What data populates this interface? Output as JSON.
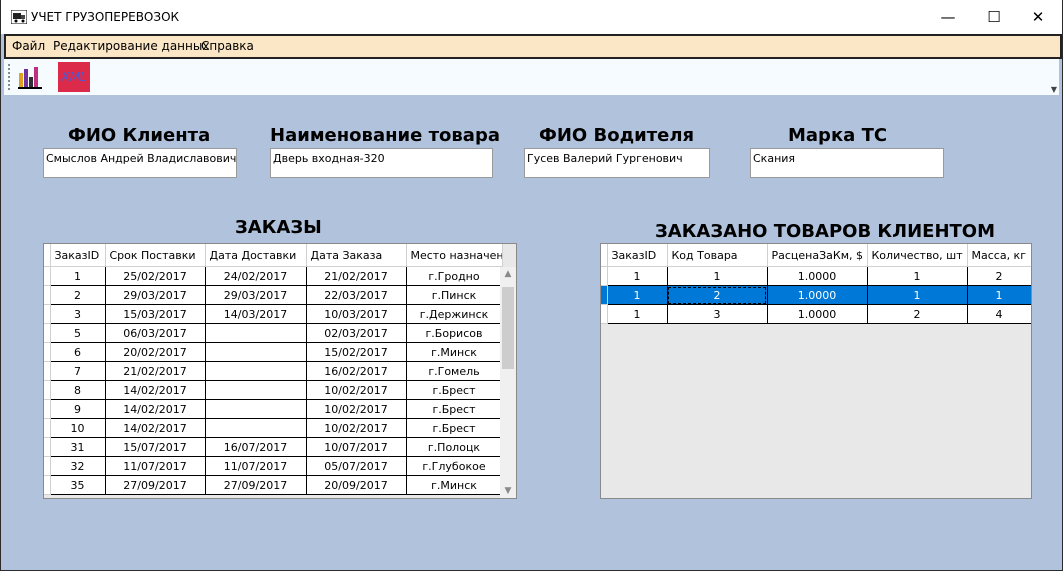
{
  "window": {
    "title": "УЧЕТ ГРУЗОПЕРЕВОЗОК",
    "minimize": "—",
    "maximize": "☐",
    "close": "✕"
  },
  "menu": [
    "Файл",
    "Редактирование данных",
    "Справка"
  ],
  "toolbar": {
    "chart_icon": "bar-chart-icon",
    "xml_label": "XML"
  },
  "fields": {
    "client_label": "ФИО Клиента",
    "client_value": "Смыслов Андрей Владиславович",
    "product_label": "Наименование товара",
    "product_value": "Дверь входная-320",
    "driver_label": "ФИО Водителя",
    "driver_value": "Гусев Валерий Гургенович",
    "vehicle_label": "Марка ТС",
    "vehicle_value": "Скания"
  },
  "orders": {
    "title": "ЗАКАЗЫ",
    "columns": [
      "ЗаказID",
      "Срок Поставки",
      "Дата Доставки",
      "Дата Заказа",
      "Место назначения"
    ],
    "rows": [
      [
        "1",
        "25/02/2017",
        "24/02/2017",
        "21/02/2017",
        "г.Гродно"
      ],
      [
        "2",
        "29/03/2017",
        "29/03/2017",
        "22/03/2017",
        "г.Пинск"
      ],
      [
        "3",
        "15/03/2017",
        "14/03/2017",
        "10/03/2017",
        "г.Держинск"
      ],
      [
        "5",
        "06/03/2017",
        "",
        "02/03/2017",
        "г.Борисов"
      ],
      [
        "6",
        "20/02/2017",
        "",
        "15/02/2017",
        "г.Минск"
      ],
      [
        "7",
        "21/02/2017",
        "",
        "16/02/2017",
        "г.Гомель"
      ],
      [
        "8",
        "14/02/2017",
        "",
        "10/02/2017",
        "г.Брест"
      ],
      [
        "9",
        "14/02/2017",
        "",
        "10/02/2017",
        "г.Брест"
      ],
      [
        "10",
        "14/02/2017",
        "",
        "10/02/2017",
        "г.Брест"
      ],
      [
        "31",
        "15/07/2017",
        "16/07/2017",
        "10/07/2017",
        "г.Полоцк"
      ],
      [
        "32",
        "11/07/2017",
        "11/07/2017",
        "05/07/2017",
        "г.Глубокое"
      ],
      [
        "35",
        "27/09/2017",
        "27/09/2017",
        "20/09/2017",
        "г.Минск"
      ]
    ]
  },
  "goods": {
    "title": "ЗАКАЗАНО ТОВАРОВ КЛИЕНТОМ",
    "columns": [
      "ЗаказID",
      "Код Товара",
      "РасценаЗаКм, $",
      "Количество, шт",
      "Масса, кг"
    ],
    "rows": [
      [
        "1",
        "1",
        "1.0000",
        "1",
        "2"
      ],
      [
        "1",
        "2",
        "1.0000",
        "1",
        "1"
      ],
      [
        "1",
        "3",
        "1.0000",
        "2",
        "4"
      ]
    ],
    "selected_row": 1
  },
  "colors": {
    "background": "#b1c3dc",
    "menubar": "#fbe6c6",
    "selection": "#0078d7",
    "xml_button": "#dc2a4a"
  }
}
